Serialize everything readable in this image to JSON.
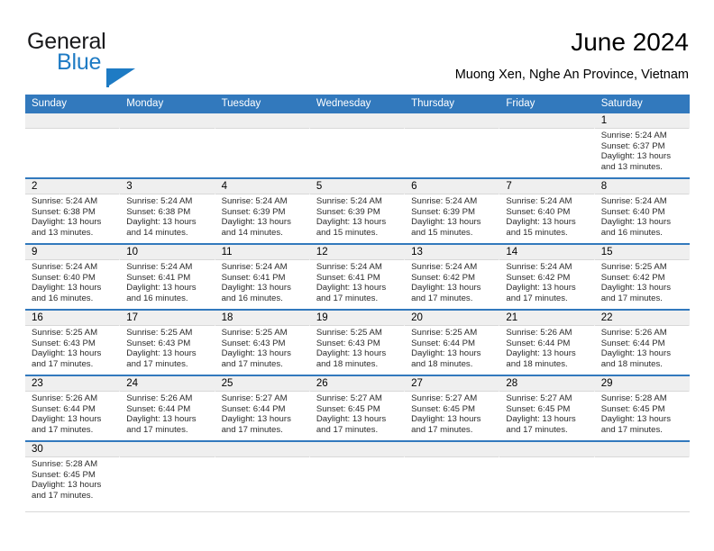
{
  "brand": {
    "name_top": "General",
    "name_bottom": "Blue",
    "flag_color": "#1e7bc4",
    "top_color": "#19191b"
  },
  "header": {
    "title": "June 2024",
    "subtitle": "Muong Xen, Nghe An Province, Vietnam"
  },
  "colors": {
    "header_blue": "#3279bd",
    "date_strip": "#efefef",
    "grid_line": "#d8d8d8"
  },
  "weekdays": [
    "Sunday",
    "Monday",
    "Tuesday",
    "Wednesday",
    "Thursday",
    "Friday",
    "Saturday"
  ],
  "weeks": [
    [
      {
        "day": ""
      },
      {
        "day": ""
      },
      {
        "day": ""
      },
      {
        "day": ""
      },
      {
        "day": ""
      },
      {
        "day": ""
      },
      {
        "day": "1",
        "sunrise": "Sunrise: 5:24 AM",
        "sunset": "Sunset: 6:37 PM",
        "daylight1": "Daylight: 13 hours",
        "daylight2": "and 13 minutes."
      }
    ],
    [
      {
        "day": "2",
        "sunrise": "Sunrise: 5:24 AM",
        "sunset": "Sunset: 6:38 PM",
        "daylight1": "Daylight: 13 hours",
        "daylight2": "and 13 minutes."
      },
      {
        "day": "3",
        "sunrise": "Sunrise: 5:24 AM",
        "sunset": "Sunset: 6:38 PM",
        "daylight1": "Daylight: 13 hours",
        "daylight2": "and 14 minutes."
      },
      {
        "day": "4",
        "sunrise": "Sunrise: 5:24 AM",
        "sunset": "Sunset: 6:39 PM",
        "daylight1": "Daylight: 13 hours",
        "daylight2": "and 14 minutes."
      },
      {
        "day": "5",
        "sunrise": "Sunrise: 5:24 AM",
        "sunset": "Sunset: 6:39 PM",
        "daylight1": "Daylight: 13 hours",
        "daylight2": "and 15 minutes."
      },
      {
        "day": "6",
        "sunrise": "Sunrise: 5:24 AM",
        "sunset": "Sunset: 6:39 PM",
        "daylight1": "Daylight: 13 hours",
        "daylight2": "and 15 minutes."
      },
      {
        "day": "7",
        "sunrise": "Sunrise: 5:24 AM",
        "sunset": "Sunset: 6:40 PM",
        "daylight1": "Daylight: 13 hours",
        "daylight2": "and 15 minutes."
      },
      {
        "day": "8",
        "sunrise": "Sunrise: 5:24 AM",
        "sunset": "Sunset: 6:40 PM",
        "daylight1": "Daylight: 13 hours",
        "daylight2": "and 16 minutes."
      }
    ],
    [
      {
        "day": "9",
        "sunrise": "Sunrise: 5:24 AM",
        "sunset": "Sunset: 6:40 PM",
        "daylight1": "Daylight: 13 hours",
        "daylight2": "and 16 minutes."
      },
      {
        "day": "10",
        "sunrise": "Sunrise: 5:24 AM",
        "sunset": "Sunset: 6:41 PM",
        "daylight1": "Daylight: 13 hours",
        "daylight2": "and 16 minutes."
      },
      {
        "day": "11",
        "sunrise": "Sunrise: 5:24 AM",
        "sunset": "Sunset: 6:41 PM",
        "daylight1": "Daylight: 13 hours",
        "daylight2": "and 16 minutes."
      },
      {
        "day": "12",
        "sunrise": "Sunrise: 5:24 AM",
        "sunset": "Sunset: 6:41 PM",
        "daylight1": "Daylight: 13 hours",
        "daylight2": "and 17 minutes."
      },
      {
        "day": "13",
        "sunrise": "Sunrise: 5:24 AM",
        "sunset": "Sunset: 6:42 PM",
        "daylight1": "Daylight: 13 hours",
        "daylight2": "and 17 minutes."
      },
      {
        "day": "14",
        "sunrise": "Sunrise: 5:24 AM",
        "sunset": "Sunset: 6:42 PM",
        "daylight1": "Daylight: 13 hours",
        "daylight2": "and 17 minutes."
      },
      {
        "day": "15",
        "sunrise": "Sunrise: 5:25 AM",
        "sunset": "Sunset: 6:42 PM",
        "daylight1": "Daylight: 13 hours",
        "daylight2": "and 17 minutes."
      }
    ],
    [
      {
        "day": "16",
        "sunrise": "Sunrise: 5:25 AM",
        "sunset": "Sunset: 6:43 PM",
        "daylight1": "Daylight: 13 hours",
        "daylight2": "and 17 minutes."
      },
      {
        "day": "17",
        "sunrise": "Sunrise: 5:25 AM",
        "sunset": "Sunset: 6:43 PM",
        "daylight1": "Daylight: 13 hours",
        "daylight2": "and 17 minutes."
      },
      {
        "day": "18",
        "sunrise": "Sunrise: 5:25 AM",
        "sunset": "Sunset: 6:43 PM",
        "daylight1": "Daylight: 13 hours",
        "daylight2": "and 17 minutes."
      },
      {
        "day": "19",
        "sunrise": "Sunrise: 5:25 AM",
        "sunset": "Sunset: 6:43 PM",
        "daylight1": "Daylight: 13 hours",
        "daylight2": "and 18 minutes."
      },
      {
        "day": "20",
        "sunrise": "Sunrise: 5:25 AM",
        "sunset": "Sunset: 6:44 PM",
        "daylight1": "Daylight: 13 hours",
        "daylight2": "and 18 minutes."
      },
      {
        "day": "21",
        "sunrise": "Sunrise: 5:26 AM",
        "sunset": "Sunset: 6:44 PM",
        "daylight1": "Daylight: 13 hours",
        "daylight2": "and 18 minutes."
      },
      {
        "day": "22",
        "sunrise": "Sunrise: 5:26 AM",
        "sunset": "Sunset: 6:44 PM",
        "daylight1": "Daylight: 13 hours",
        "daylight2": "and 18 minutes."
      }
    ],
    [
      {
        "day": "23",
        "sunrise": "Sunrise: 5:26 AM",
        "sunset": "Sunset: 6:44 PM",
        "daylight1": "Daylight: 13 hours",
        "daylight2": "and 17 minutes."
      },
      {
        "day": "24",
        "sunrise": "Sunrise: 5:26 AM",
        "sunset": "Sunset: 6:44 PM",
        "daylight1": "Daylight: 13 hours",
        "daylight2": "and 17 minutes."
      },
      {
        "day": "25",
        "sunrise": "Sunrise: 5:27 AM",
        "sunset": "Sunset: 6:44 PM",
        "daylight1": "Daylight: 13 hours",
        "daylight2": "and 17 minutes."
      },
      {
        "day": "26",
        "sunrise": "Sunrise: 5:27 AM",
        "sunset": "Sunset: 6:45 PM",
        "daylight1": "Daylight: 13 hours",
        "daylight2": "and 17 minutes."
      },
      {
        "day": "27",
        "sunrise": "Sunrise: 5:27 AM",
        "sunset": "Sunset: 6:45 PM",
        "daylight1": "Daylight: 13 hours",
        "daylight2": "and 17 minutes."
      },
      {
        "day": "28",
        "sunrise": "Sunrise: 5:27 AM",
        "sunset": "Sunset: 6:45 PM",
        "daylight1": "Daylight: 13 hours",
        "daylight2": "and 17 minutes."
      },
      {
        "day": "29",
        "sunrise": "Sunrise: 5:28 AM",
        "sunset": "Sunset: 6:45 PM",
        "daylight1": "Daylight: 13 hours",
        "daylight2": "and 17 minutes."
      }
    ],
    [
      {
        "day": "30",
        "sunrise": "Sunrise: 5:28 AM",
        "sunset": "Sunset: 6:45 PM",
        "daylight1": "Daylight: 13 hours",
        "daylight2": "and 17 minutes."
      },
      {
        "day": ""
      },
      {
        "day": ""
      },
      {
        "day": ""
      },
      {
        "day": ""
      },
      {
        "day": ""
      },
      {
        "day": ""
      }
    ]
  ]
}
